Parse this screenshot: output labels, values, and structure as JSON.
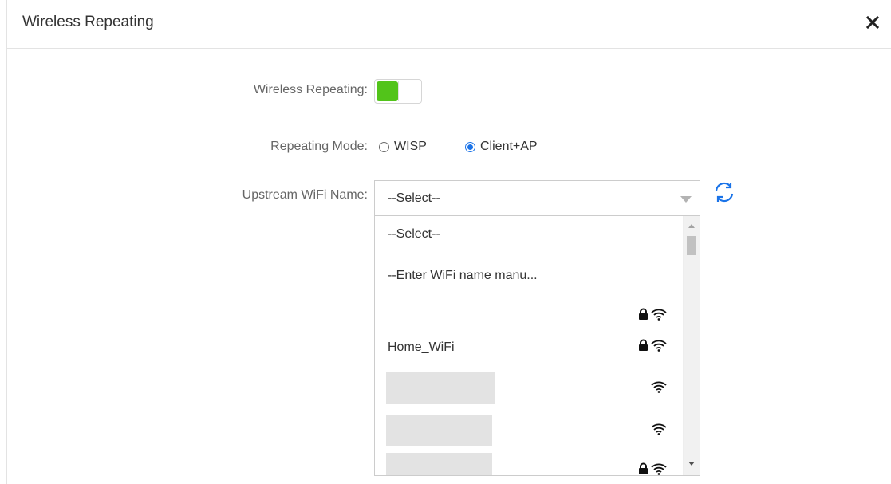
{
  "dialog": {
    "title": "Wireless Repeating",
    "close_icon": "close-icon"
  },
  "form": {
    "wireless_repeating_label": "Wireless Repeating:",
    "wireless_repeating_enabled": true,
    "repeating_mode_label": "Repeating Mode:",
    "modes": [
      {
        "label": "WISP",
        "checked": false
      },
      {
        "label": "Client+AP",
        "checked": true
      }
    ],
    "upstream_label": "Upstream WiFi Name:",
    "select_value": "--Select--",
    "refresh_icon": "refresh-icon"
  },
  "dropdown": {
    "items": [
      {
        "label": "--Select--",
        "lock": false,
        "wifi": false
      },
      {
        "label": "--Enter WiFi name manu...",
        "lock": false,
        "wifi": false
      },
      {
        "label": "",
        "lock": true,
        "wifi": true
      },
      {
        "label": "Home_WiFi",
        "lock": true,
        "wifi": true
      },
      {
        "label": "",
        "lock": false,
        "wifi": true,
        "redacted": true
      },
      {
        "label": "",
        "lock": false,
        "wifi": true,
        "redacted": true
      },
      {
        "label": "",
        "lock": true,
        "wifi": true,
        "redacted": true
      }
    ]
  },
  "colors": {
    "toggle_on": "#52c41a",
    "radio_checked": "#1a73e8",
    "refresh_icon": "#1a73e8"
  }
}
